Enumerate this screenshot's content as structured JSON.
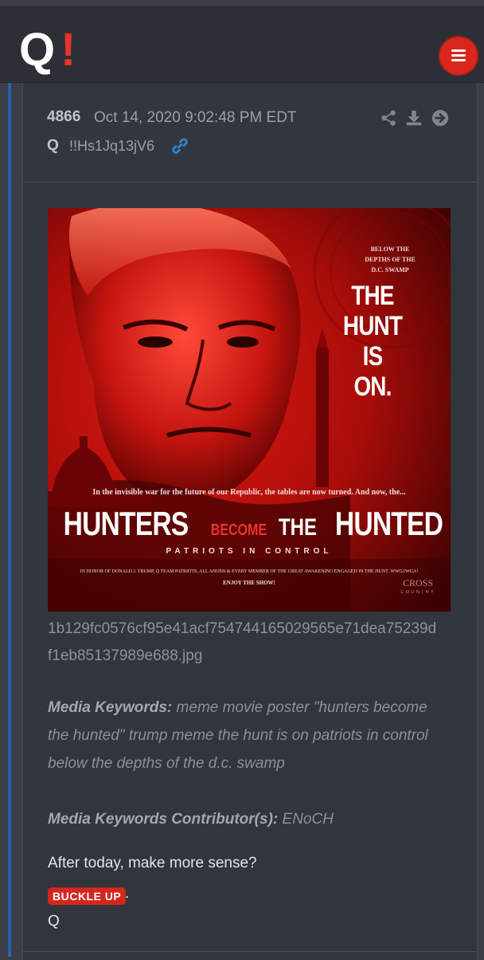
{
  "app": {
    "logo_q": "Q",
    "logo_bang": "!",
    "menu_icon": "hamburger-icon",
    "accent": "#d9261c"
  },
  "post": {
    "number": "4866",
    "date": "Oct 14, 2020 9:02:48 PM EDT",
    "author": "Q",
    "tripcode": "!!Hs1Jq13jV6",
    "actions": [
      "share-icon",
      "download-icon",
      "arrow-right-icon"
    ],
    "image": {
      "tag": "BELOW THE\nDEPTHS OF THE\nD.C. SWAMP",
      "hunt": "THE\nHUNT\nIS\nON.",
      "tagline": "In the invisible war for the future of our Republic, the tables are now turned. And now, the...",
      "title_a": "HUNTERS",
      "title_b": "BECOME",
      "title_c": "THE",
      "title_d": "HUNTED",
      "subtitle": "PATRIOTS IN CONTROL",
      "honor": "IN HONOR OF DONALD J. TRUMP, Q TEAM PATRIOTS, ALL ANONS & EVERY MEMBER OF THE GREAT AWAKENING ENGAGED IN THE HUNT. WWG1WGA!",
      "enjoy": "ENJOY THE SHOW!",
      "brand": "CROSS",
      "brand_sub": "COUNTRY"
    },
    "filename_line1": "1b129fc0576cf95e41acf754744165029565e71dea75239d",
    "filename_line2": "f1eb85137989e688.jpg",
    "keywords_label": "Media Keywords:",
    "keywords": "meme movie poster \"hunters become the hunted\" trump meme the hunt is on patriots in control below the depths of the d.c. swamp",
    "contributor_label": "Media Keywords Contributor(s):",
    "contributor": "ENoCH",
    "message": "After today, make more sense?",
    "badge": "BUCKLE UP",
    "badge_suffix": ".",
    "signature": "Q",
    "bar_color": "#2563b0"
  }
}
